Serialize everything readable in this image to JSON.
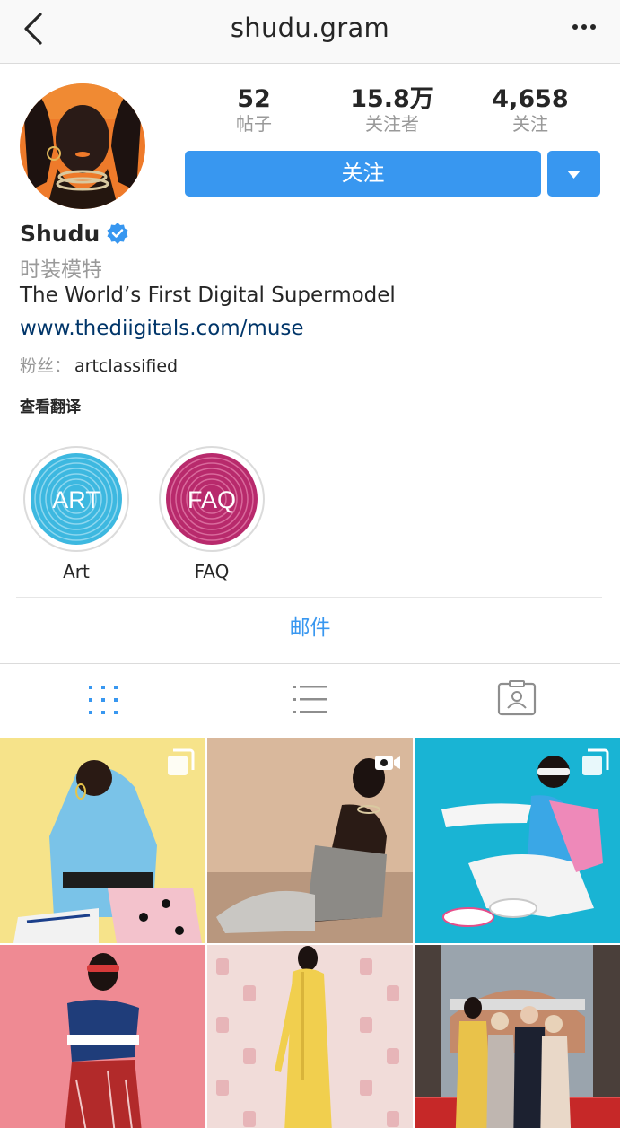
{
  "header": {
    "title": "shudu.gram",
    "back_icon": "chevron-left-icon",
    "more_icon": "more-horizontal-icon"
  },
  "profile": {
    "name": "Shudu",
    "verified": true,
    "category": "时装模特",
    "bio": "The World’s First Digital Supermodel",
    "link": "www.thediigitals.com/muse",
    "followed_by_label": "粉丝：",
    "followed_by_user": "artclassified",
    "translate_label": "查看翻译"
  },
  "stats": [
    {
      "value": "52",
      "label": "帖子"
    },
    {
      "value": "15.8万",
      "label": "关注者"
    },
    {
      "value": "4,658",
      "label": "关注"
    }
  ],
  "actions": {
    "follow_label": "关注",
    "dropdown_icon": "caret-down-icon",
    "email_label": "邮件"
  },
  "highlights": [
    {
      "label": "Art",
      "cover_text": "ART",
      "color": "#3db8e0"
    },
    {
      "label": "FAQ",
      "cover_text": "FAQ",
      "color": "#b82a6c"
    }
  ],
  "tabs": [
    {
      "icon": "grid-icon",
      "active": true
    },
    {
      "icon": "list-icon",
      "active": false
    },
    {
      "icon": "tagged-icon",
      "active": false
    }
  ],
  "posts": [
    {
      "type": "carousel",
      "bg": "#f6e38a"
    },
    {
      "type": "video",
      "bg": "#d9b89c"
    },
    {
      "type": "carousel",
      "bg": "#19b4d4"
    },
    {
      "type": "photo",
      "bg": "#ef8a93"
    },
    {
      "type": "photo",
      "bg": "#f1dcd9"
    },
    {
      "type": "photo",
      "bg": "#b9332e"
    }
  ],
  "colors": {
    "accent": "#3897f0",
    "link": "#003569",
    "muted": "#999999"
  }
}
